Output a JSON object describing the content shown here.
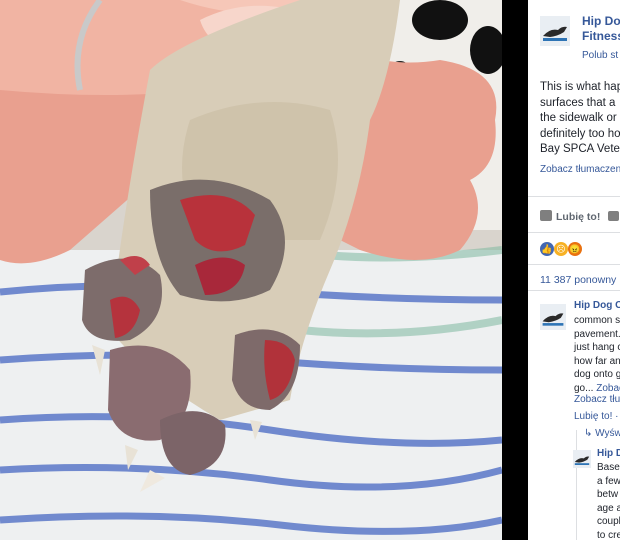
{
  "post": {
    "page_name_lines": [
      "Hip Do",
      "Fitness"
    ],
    "follow_label": "Polub st",
    "text_lines": [
      "This is what hap",
      "surfaces that a",
      "the sidewalk or",
      "definitely too ho",
      "Bay SPCA Vete"
    ],
    "translate_label": "Zobacz tłumaczen"
  },
  "actions": {
    "like_label": "Lubię to!"
  },
  "reactions": {
    "icons": [
      "like-reaction",
      "sad-reaction",
      "angry-reaction"
    ],
    "colors": {
      "like": "#4267b2",
      "sad": "#f7b125",
      "angry": "#e9710f"
    }
  },
  "shares_label": "11 387 ponowny",
  "comment": {
    "name": "Hip Dog Ca",
    "lines": [
      "common s",
      "pavement.",
      "just hang c",
      "how far an",
      "dog onto g"
    ],
    "last_line": "go...",
    "more_label": "Zobac",
    "translate_label": "Zobacz tłum",
    "like_label": "Lubię to! ·"
  },
  "replies": {
    "show_label": "↳ Wyśw"
  },
  "reply": {
    "name": "Hip Do",
    "lines": [
      "Base",
      "a few",
      "betw",
      "age a",
      "coupl",
      "to cre"
    ]
  },
  "colors": {
    "link": "#365899",
    "text": "#1d2129",
    "muted": "#606770"
  }
}
